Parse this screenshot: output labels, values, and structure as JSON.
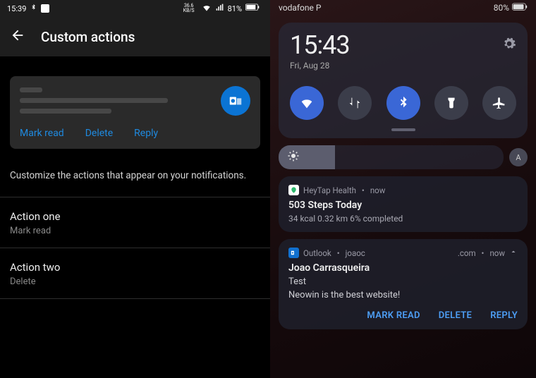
{
  "left": {
    "status": {
      "time": "15:39",
      "net_rate": "36.6",
      "net_unit": "KB/S",
      "battery": "81%"
    },
    "title": "Custom actions",
    "preview_actions": [
      "Mark read",
      "Delete",
      "Reply"
    ],
    "description": "Customize the actions that appear on your notifications.",
    "rows": [
      {
        "label": "Action one",
        "value": "Mark read"
      },
      {
        "label": "Action two",
        "value": "Delete"
      }
    ]
  },
  "right": {
    "status": {
      "carrier": "vodafone P",
      "battery": "80%"
    },
    "qs": {
      "clock": "15:43",
      "date": "Fri, Aug 28",
      "tiles": [
        {
          "name": "wifi",
          "on": true
        },
        {
          "name": "data",
          "on": false
        },
        {
          "name": "bluetooth",
          "on": true
        },
        {
          "name": "flashlight",
          "on": false
        },
        {
          "name": "airplane",
          "on": false
        }
      ],
      "auto_brightness_label": "A"
    },
    "notifs": [
      {
        "app": "HeyTap Health",
        "when": "now",
        "title": "503 Steps Today",
        "sub": "34 kcal   0.32 km   6% completed"
      },
      {
        "app": "Outlook",
        "account": "joaoc",
        "domain": ".com",
        "when": "now",
        "title": "Joao Carrasqueira",
        "subject": "Test",
        "body": "Neowin is the best website!",
        "actions": [
          "MARK READ",
          "DELETE",
          "REPLY"
        ]
      }
    ]
  }
}
